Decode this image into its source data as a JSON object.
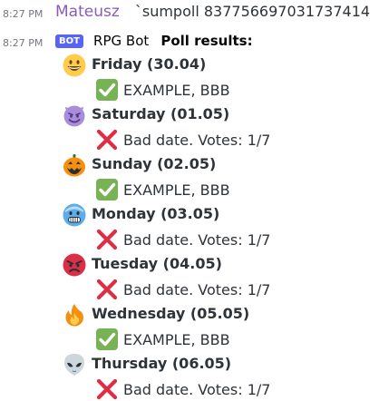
{
  "messages": [
    {
      "timestamp": "8:27 PM",
      "username": "Mateusz",
      "content": "`sumpoll 837756697031737414"
    },
    {
      "timestamp": "8:27 PM",
      "badge": "BOT",
      "username": "RPG Bot",
      "title": "Poll results:"
    }
  ],
  "poll": {
    "days": [
      {
        "emoji": "grinning-face-icon",
        "label": "Friday (30.04)",
        "result_icon": "check-mark-icon",
        "result": "EXAMPLE, BBB"
      },
      {
        "emoji": "smiling-imp-icon",
        "label": "Saturday (01.05)",
        "result_icon": "cross-mark-icon",
        "result": "Bad date. Votes: 1/7"
      },
      {
        "emoji": "jack-o-lantern-icon",
        "label": "Sunday (02.05)",
        "result_icon": "check-mark-icon",
        "result": "EXAMPLE, BBB"
      },
      {
        "emoji": "cold-face-icon",
        "label": "Monday (03.05)",
        "result_icon": "cross-mark-icon",
        "result": "Bad date. Votes: 1/7"
      },
      {
        "emoji": "angry-face-icon",
        "label": "Tuesday (04.05)",
        "result_icon": "cross-mark-icon",
        "result": "Bad date. Votes: 1/7"
      },
      {
        "emoji": "fire-icon",
        "label": "Wednesday (05.05)",
        "result_icon": "check-mark-icon",
        "result": "EXAMPLE, BBB"
      },
      {
        "emoji": "alien-icon",
        "label": "Thursday (06.05)",
        "result_icon": "cross-mark-icon",
        "result": "Bad date. Votes: 1/7"
      }
    ]
  },
  "colors": {
    "user_name": "#8a5bb8",
    "bot_badge": "#5865f2",
    "check": "#77b255",
    "cross": "#dd2e44",
    "timestamp": "#72767d"
  }
}
